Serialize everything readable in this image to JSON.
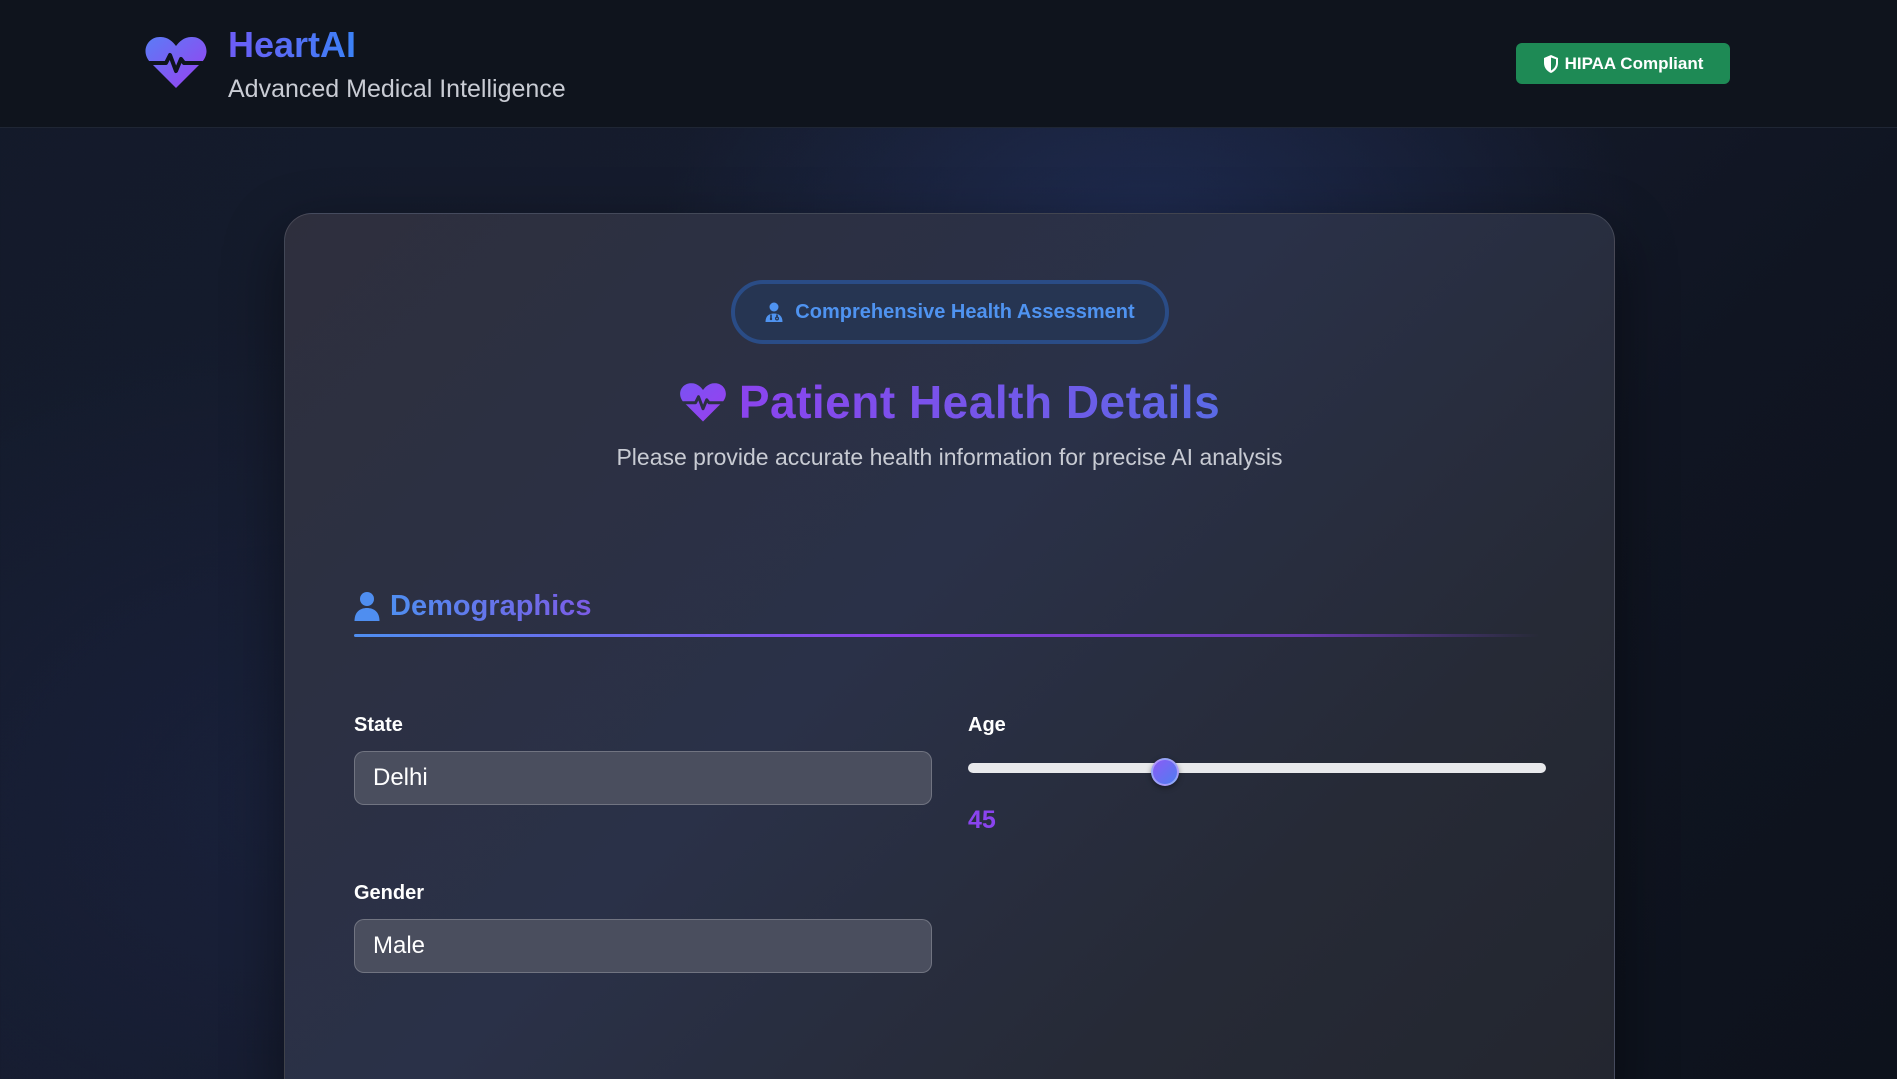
{
  "header": {
    "logo_icon": "heart-pulse-icon",
    "brand_name": "HeartAI",
    "tagline": "Advanced Medical Intelligence",
    "compliance_badge": "HIPAA Compliant",
    "compliance_icon": "shield-icon",
    "compliance_color": "#1e8a55"
  },
  "form": {
    "pill_label": "Comprehensive Health Assessment",
    "pill_icon": "doctor-icon",
    "title": "Patient Health Details",
    "title_icon": "heart-pulse-icon",
    "subtitle": "Please provide accurate health information for precise AI analysis",
    "sections": [
      {
        "title": "Demographics",
        "icon": "user-icon",
        "fields": {
          "state": {
            "label": "State",
            "value": "Delhi"
          },
          "gender": {
            "label": "Gender",
            "value": "Male"
          },
          "age": {
            "label": "Age",
            "value": "45",
            "slider_fraction": 0.34
          }
        }
      }
    ]
  },
  "colors": {
    "accent_purple": "#8a44ee",
    "accent_blue": "#4f8ef0",
    "badge_green": "#1e8a55"
  }
}
